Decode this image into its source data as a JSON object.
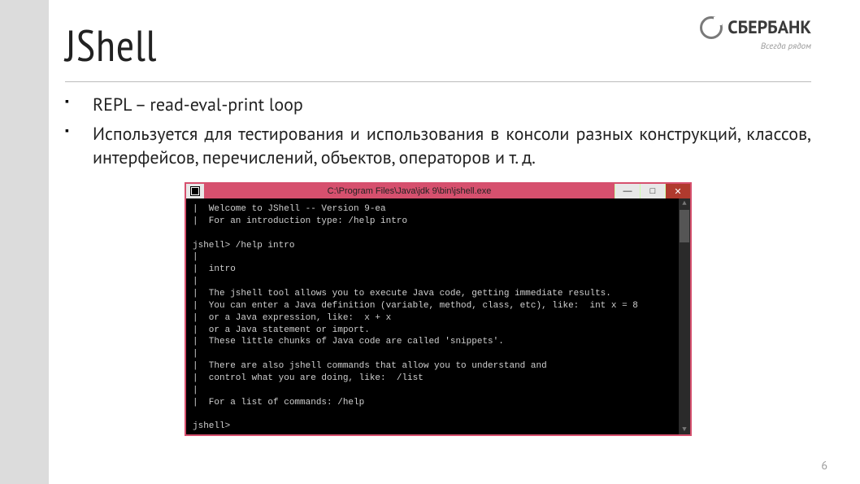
{
  "title": "JShell",
  "logo": {
    "brand": "СБЕРБАНК",
    "tagline": "Всегда рядом"
  },
  "bullets": [
    "REPL – read-eval-print loop",
    "Используется для тестирования и использования в консоли разных конструкций, классов, интерфейсов, перечислений, объектов, операторов и т. д."
  ],
  "terminal": {
    "title": "C:\\Program Files\\Java\\jdk 9\\bin\\jshell.exe",
    "buttons": {
      "min": "—",
      "max": "□",
      "close": "✕"
    },
    "body": "|  Welcome to JShell -- Version 9-ea\n|  For an introduction type: /help intro\n\njshell> /help intro\n|\n|  intro\n|\n|  The jshell tool allows you to execute Java code, getting immediate results.\n|  You can enter a Java definition (variable, method, class, etc), like:  int x = 8\n|  or a Java expression, like:  x + x\n|  or a Java statement or import.\n|  These little chunks of Java code are called 'snippets'.\n|\n|  There are also jshell commands that allow you to understand and\n|  control what you are doing, like:  /list\n|\n|  For a list of commands: /help\n\njshell>"
  },
  "page_number": "6"
}
